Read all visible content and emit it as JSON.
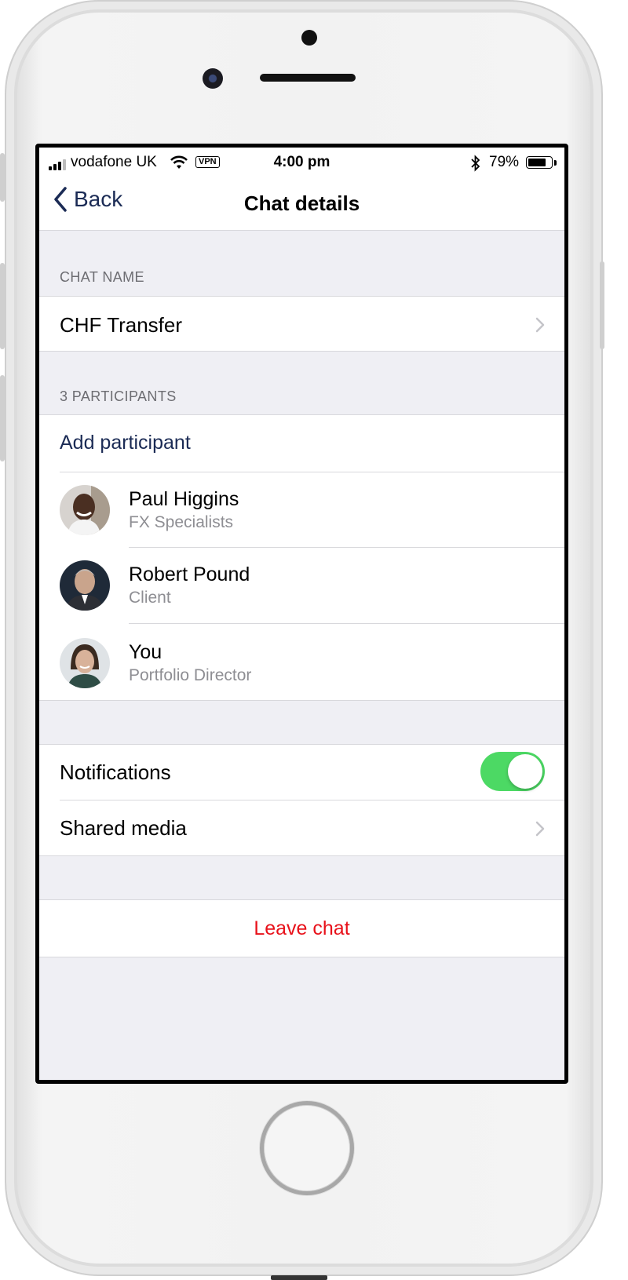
{
  "status_bar": {
    "carrier": "vodafone UK",
    "vpn": "VPN",
    "time": "4:00 pm",
    "bluetooth_icon": "bluetooth-icon",
    "battery_percent": "79%",
    "battery_level": 0.79
  },
  "nav": {
    "back_label": "Back",
    "title": "Chat details"
  },
  "chat_name": {
    "header": "CHAT NAME",
    "value": "CHF Transfer"
  },
  "participants": {
    "header": "3 PARTICIPANTS",
    "add_label": "Add participant",
    "items": [
      {
        "name": "Paul Higgins",
        "role": "FX Specialists"
      },
      {
        "name": "Robert Pound",
        "role": "Client"
      },
      {
        "name": "You",
        "role": "Portfolio Director"
      }
    ]
  },
  "settings": {
    "notifications_label": "Notifications",
    "notifications_on": true,
    "shared_media_label": "Shared media"
  },
  "actions": {
    "leave_label": "Leave chat"
  },
  "colors": {
    "accent": "#1b2b55",
    "toggle_on": "#4cd964",
    "destructive": "#e8111a",
    "group_bg": "#efeff4"
  }
}
